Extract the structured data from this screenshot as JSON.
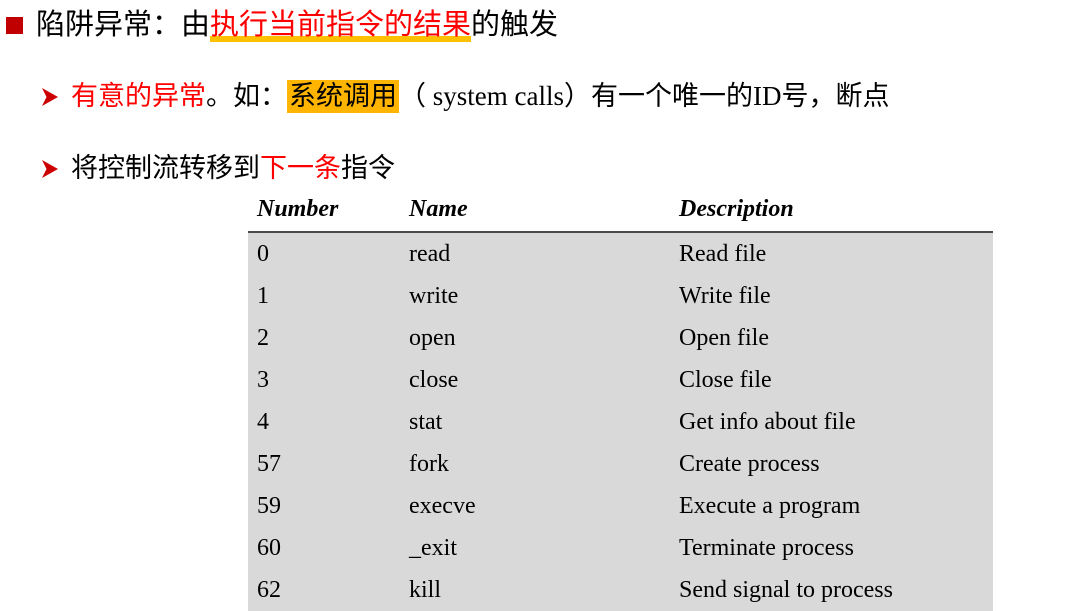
{
  "slide": {
    "bullet1": {
      "marker": "square-bullet",
      "prefix": "陷阱异常：由",
      "highlighted_underlined": "执行当前指令的结果",
      "suffix": "的触发"
    },
    "bullet2": {
      "marker": "arrow-bullet",
      "part1": "有意的异常",
      "part2": "。如：",
      "highlight": "系统调用",
      "part3": "（ system calls）有一个唯一的ID号，断点"
    },
    "bullet3": {
      "marker": "arrow-bullet",
      "part1": "将控制流转移到",
      "part2": "下一条",
      "part3": "指令"
    }
  },
  "table": {
    "headers": [
      "Number",
      "Name",
      "Description"
    ],
    "rows": [
      {
        "number": "0",
        "name": "read",
        "description": "Read file"
      },
      {
        "number": "1",
        "name": "write",
        "description": "Write file"
      },
      {
        "number": "2",
        "name": "open",
        "description": "Open file"
      },
      {
        "number": "3",
        "name": "close",
        "description": "Close file"
      },
      {
        "number": "4",
        "name": "stat",
        "description": "Get info about file"
      },
      {
        "number": "57",
        "name": "fork",
        "description": "Create process"
      },
      {
        "number": "59",
        "name": "execve",
        "description": "Execute a program"
      },
      {
        "number": "60",
        "name": "_exit",
        "description": "Terminate process"
      },
      {
        "number": "62",
        "name": "kill",
        "description": "Send signal to process"
      }
    ]
  },
  "colors": {
    "bullet_square": "#C00000",
    "arrow_red": "#CC0000",
    "emphasis_red": "#FF0000",
    "underline_gold": "#FFC000",
    "highlight_orange": "#FFB400",
    "table_body_bg": "#D9D9D9",
    "header_rule": "#4A4A4A"
  }
}
